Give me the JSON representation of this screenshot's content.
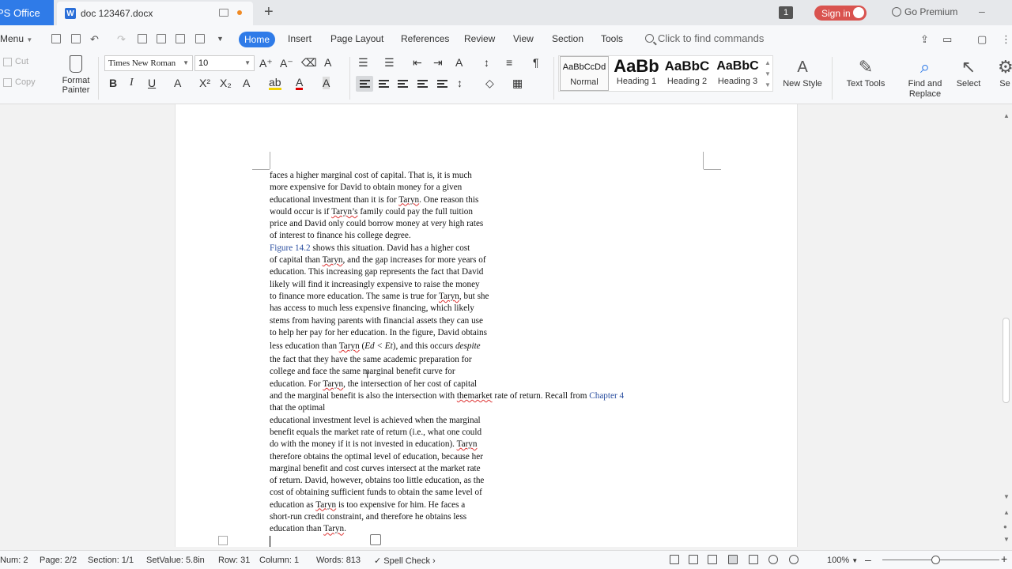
{
  "titlebar": {
    "office_tab": "PS Office",
    "doc_tab": "doc 123467.docx",
    "count_badge": "1",
    "sign_in": "Sign in",
    "premium": "Go Premium"
  },
  "menu": {
    "menu_label": "Menu",
    "tabs": [
      "Home",
      "Insert",
      "Page Layout",
      "References",
      "Review",
      "View",
      "Section",
      "Tools"
    ],
    "search_commands": "Click to find commands"
  },
  "ribbon": {
    "cut": "Cut",
    "copy": "Copy",
    "format_painter_1": "Format",
    "format_painter_2": "Painter",
    "font_name": "Times New Roman",
    "font_size": "10",
    "styles": [
      {
        "preview": "AaBbCcDd",
        "label": "Normal"
      },
      {
        "preview": "AaBb",
        "label": "Heading 1"
      },
      {
        "preview": "AaBbC",
        "label": "Heading 2"
      },
      {
        "preview": "AaBbC",
        "label": "Heading 3"
      }
    ],
    "new_style": "New Style",
    "text_tools": "Text Tools",
    "find_replace_1": "Find and",
    "find_replace_2": "Replace",
    "select": "Select",
    "cut_off": "Se"
  },
  "document": {
    "lines": [
      "faces a higher marginal cost of capital. That is, it is much",
      "more expensive for David to obtain money for a given",
      "educational investment than it is for Taryn. One reason this",
      "would occur is if Taryn’s family could pay the full tuition",
      "price and David only could borrow money at very high rates",
      "of interest to finance his college degree.",
      "Figure 14.2 shows this situation. David has a higher cost",
      "of capital than Taryn, and the gap increases for more years of",
      "education. This increasing gap represents the fact that David",
      "likely will find it increasingly expensive to raise the money",
      "to finance more education. The same is true for Taryn, but she",
      "has access to much less expensive financing, which likely",
      "stems from having parents with financial assets they can use",
      "to help her pay for her education. In the figure, David obtains",
      "less education than Taryn (Ed < Et), and this occurs despite",
      "the fact that they have the same academic preparation for",
      "college and face the same marginal benefit curve for",
      "education. For Taryn, the intersection of her cost of capital",
      "and the marginal benefit is also the intersection with themarket rate of return. Recall from Chapter 4",
      "that the optimal",
      "educational investment level is achieved when the marginal",
      "benefit equals the market rate of return (i.e., what one could",
      "do with the money if it is not invested in education). Taryn",
      "therefore obtains the optimal level of education, because her",
      "marginal benefit and cost curves intersect at the market rate",
      "of return. David, however, obtains too little education, as the",
      "cost of obtaining sufficient funds to obtain the same level of",
      "education as Taryn is too expensive for him. He faces a",
      "short-run credit constraint, and therefore he obtains less",
      "education than Taryn."
    ]
  },
  "status": {
    "num": "Num: 2",
    "page": "Page: 2/2",
    "section": "Section: 1/1",
    "setvalue": "SetValue: 5.8in",
    "row": "Row: 31",
    "column": "Column: 1",
    "words": "Words: 813",
    "spell": "Spell Check",
    "zoom": "100%"
  }
}
